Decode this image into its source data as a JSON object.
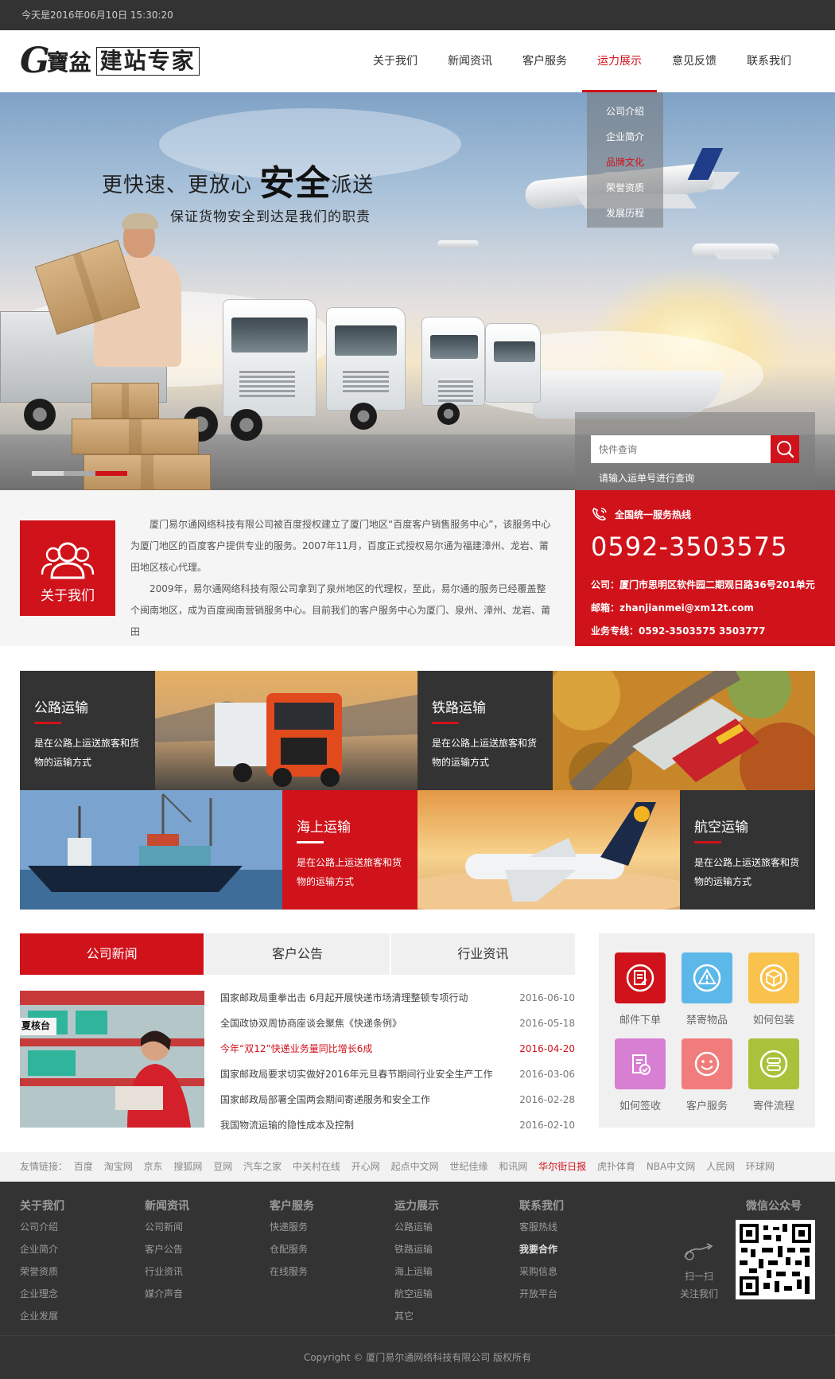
{
  "topbar": {
    "date_text": "今天是2016年06月10日   15:30:20"
  },
  "logo": {
    "g": "G",
    "calli": "寶盆",
    "box_text": "建站专家"
  },
  "nav": {
    "items": [
      {
        "label": "关于我们"
      },
      {
        "label": "新闻资讯"
      },
      {
        "label": "客户服务"
      },
      {
        "label": "运力展示",
        "active": true
      },
      {
        "label": "意见反馈"
      },
      {
        "label": "联系我们"
      }
    ]
  },
  "dropdown": {
    "items": [
      {
        "label": "公司介绍"
      },
      {
        "label": "企业简介"
      },
      {
        "label": "品牌文化",
        "active": true
      },
      {
        "label": "荣誉资质"
      },
      {
        "label": "发展历程"
      }
    ]
  },
  "banner": {
    "title_pre": "更快速、更放心 ",
    "title_strong": "安全",
    "title_post": "派送",
    "subtitle": "保证货物安全到达是我们的职责"
  },
  "tracking": {
    "placeholder": "快件查询",
    "hint": "请输入运单号进行查询"
  },
  "about": {
    "badge_label": "关于我们",
    "para1": "厦门易尔通网络科技有限公司被百度授权建立了厦门地区“百度客户销售服务中心”，该服务中心为厦门地区的百度客户提供专业的服务。2007年11月，百度正式授权易尔通为福建漳州、龙岩、莆田地区核心代理。",
    "para2": "2009年，易尔通网络科技有限公司拿到了泉州地区的代理权，至此，易尔通的服务已经覆盖整个闽南地区，成为百度闽南营销服务中心。目前我们的客户服务中心为厦门、泉州、漳州、龙岩、莆田"
  },
  "contact": {
    "hotline_title": "全国统一服务热线",
    "phone": "0592-3503575",
    "address": "公司：厦门市思明区软件园二期观日路36号201单元",
    "email": "邮箱：zhanjianmei@xm12t.com",
    "business": "业务专线：0592-3503575  3503777"
  },
  "services": [
    {
      "title": "公路运输",
      "desc": "是在公路上运送旅客和货物的运输方式"
    },
    {
      "title": "铁路运输",
      "desc": "是在公路上运送旅客和货物的运输方式"
    },
    {
      "title": "海上运输",
      "desc": "是在公路上运送旅客和货物的运输方式"
    },
    {
      "title": "航空运输",
      "desc": "是在公路上运送旅客和货物的运输方式"
    }
  ],
  "news": {
    "tabs": [
      {
        "label": "公司新闻",
        "active": true
      },
      {
        "label": "客户公告"
      },
      {
        "label": "行业资讯"
      }
    ],
    "image_caption": "夏核台",
    "items": [
      {
        "title": "国家邮政局重拳出击 6月起开展快递市场清理整顿专项行动",
        "date": "2016-06-10"
      },
      {
        "title": "全国政协双周协商座谈会聚焦《快递条例》",
        "date": "2016-05-18"
      },
      {
        "title": "今年“双12”快递业务量同比增长6成",
        "date": "2016-04-20",
        "hot": true
      },
      {
        "title": "国家邮政局要求切实做好2016年元旦春节期间行业安全生产工作",
        "date": "2016-03-06"
      },
      {
        "title": "国家邮政局部署全国两会期间寄递服务和安全工作",
        "date": "2016-02-28"
      },
      {
        "title": "我国物流运输的隐性成本及控制",
        "date": "2016-02-10"
      }
    ]
  },
  "quick": {
    "items": [
      {
        "label": "邮件下单",
        "icon": "mail-order-icon",
        "color": "#d0121b"
      },
      {
        "label": "禁寄物品",
        "icon": "warning-icon",
        "color": "#5cb8e8"
      },
      {
        "label": "如何包装",
        "icon": "package-icon",
        "color": "#f9c24c"
      },
      {
        "label": "如何签收",
        "icon": "sign-icon",
        "color": "#d77fd3"
      },
      {
        "label": "客户服务",
        "icon": "smile-icon",
        "color": "#f07d7b"
      },
      {
        "label": "寄件流程",
        "icon": "flow-icon",
        "color": "#a8c23b"
      }
    ]
  },
  "friend_links": {
    "label": "友情链接：",
    "items": [
      {
        "label": "百度"
      },
      {
        "label": "淘宝网"
      },
      {
        "label": "京东"
      },
      {
        "label": "搜狐网"
      },
      {
        "label": "豆网"
      },
      {
        "label": "汽车之家"
      },
      {
        "label": "中关村在线"
      },
      {
        "label": "开心网"
      },
      {
        "label": "起点中文网"
      },
      {
        "label": "世纪佳缘"
      },
      {
        "label": "和讯网"
      },
      {
        "label": "华尔街日报",
        "hl": true
      },
      {
        "label": "虎扑体育"
      },
      {
        "label": "NBA中文网"
      },
      {
        "label": "人民网"
      },
      {
        "label": "环球网"
      }
    ]
  },
  "footer": {
    "columns": [
      {
        "title": "关于我们",
        "items": [
          "公司介绍",
          "企业简介",
          "荣誉资质",
          "企业理念",
          "企业发展"
        ]
      },
      {
        "title": "新闻资讯",
        "items": [
          "公司新闻",
          "客户公告",
          "行业资讯",
          "媒介声音"
        ]
      },
      {
        "title": "客户服务",
        "items": [
          "快递服务",
          "仓配服务",
          "在线服务"
        ]
      },
      {
        "title": "运力展示",
        "items": [
          "公路运输",
          "铁路运输",
          "海上运输",
          "航空运输",
          "其它"
        ]
      },
      {
        "title": "联系我们",
        "items": [
          "客服热线",
          "我要合作",
          "采购信息",
          "开放平台"
        ]
      }
    ],
    "wechat_title": "微信公众号",
    "scan_line1": "扫一扫",
    "scan_line2": "关注我们",
    "copyright": "Copyright © 厦门易尔通网络科技有限公司 版权所有"
  }
}
